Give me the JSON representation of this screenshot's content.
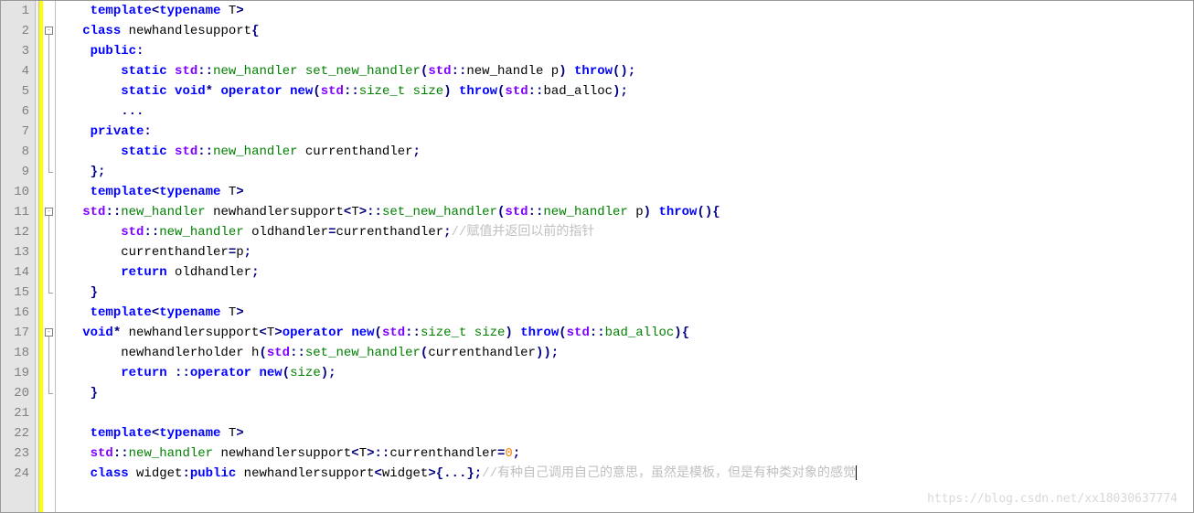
{
  "lines": [
    {
      "n": 1,
      "fold": null,
      "tokens": [
        [
          "    ",
          ""
        ],
        [
          "template",
          "kw"
        ],
        [
          "<",
          "op"
        ],
        [
          "typename",
          "kw"
        ],
        [
          " T",
          ""
        ],
        [
          ">",
          "op"
        ]
      ]
    },
    {
      "n": 2,
      "fold": "box",
      "tokens": [
        [
          "   ",
          ""
        ],
        [
          "class",
          "kw"
        ],
        [
          " newhandlesupport",
          ""
        ],
        [
          "{",
          "op"
        ]
      ]
    },
    {
      "n": 3,
      "fold": "line",
      "tokens": [
        [
          "    ",
          ""
        ],
        [
          "public",
          "kw"
        ],
        [
          ":",
          "op"
        ]
      ]
    },
    {
      "n": 4,
      "fold": "line",
      "tokens": [
        [
          "        ",
          ""
        ],
        [
          "static",
          "kw"
        ],
        [
          " ",
          ""
        ],
        [
          "std",
          "type"
        ],
        [
          "::",
          "op"
        ],
        [
          "new_handler",
          "func"
        ],
        [
          " ",
          ""
        ],
        [
          "set_new_handler",
          "func"
        ],
        [
          "(",
          "op"
        ],
        [
          "std",
          "type"
        ],
        [
          "::",
          "op"
        ],
        [
          "new_handle p",
          ""
        ],
        [
          ")",
          "op"
        ],
        [
          " ",
          ""
        ],
        [
          "throw",
          "kw"
        ],
        [
          "()",
          "op"
        ],
        [
          ";",
          "op"
        ]
      ]
    },
    {
      "n": 5,
      "fold": "line",
      "tokens": [
        [
          "        ",
          ""
        ],
        [
          "static",
          "kw"
        ],
        [
          " ",
          ""
        ],
        [
          "void",
          "kw"
        ],
        [
          "*",
          "op"
        ],
        [
          " ",
          ""
        ],
        [
          "operator",
          "kw"
        ],
        [
          " ",
          ""
        ],
        [
          "new",
          "kw"
        ],
        [
          "(",
          "op"
        ],
        [
          "std",
          "type"
        ],
        [
          "::",
          "op"
        ],
        [
          "size_t",
          "func"
        ],
        [
          " ",
          ""
        ],
        [
          "size",
          "func"
        ],
        [
          ")",
          "op"
        ],
        [
          " ",
          ""
        ],
        [
          "throw",
          "kw"
        ],
        [
          "(",
          "op"
        ],
        [
          "std",
          "type"
        ],
        [
          "::",
          "op"
        ],
        [
          "bad_alloc",
          ""
        ],
        [
          ")",
          "op"
        ],
        [
          ";",
          "op"
        ]
      ]
    },
    {
      "n": 6,
      "fold": "line",
      "tokens": [
        [
          "        ",
          ""
        ],
        [
          "...",
          "op"
        ]
      ]
    },
    {
      "n": 7,
      "fold": "line",
      "tokens": [
        [
          "    ",
          ""
        ],
        [
          "private",
          "kw"
        ],
        [
          ":",
          "op"
        ]
      ]
    },
    {
      "n": 8,
      "fold": "line",
      "tokens": [
        [
          "        ",
          ""
        ],
        [
          "static",
          "kw"
        ],
        [
          " ",
          ""
        ],
        [
          "std",
          "type"
        ],
        [
          "::",
          "op"
        ],
        [
          "new_handler",
          "func"
        ],
        [
          " currenthandler",
          ""
        ],
        [
          ";",
          "op"
        ]
      ]
    },
    {
      "n": 9,
      "fold": "end",
      "tokens": [
        [
          "    ",
          ""
        ],
        [
          "}",
          "op"
        ],
        [
          ";",
          "op"
        ]
      ]
    },
    {
      "n": 10,
      "fold": null,
      "tokens": [
        [
          "    ",
          ""
        ],
        [
          "template",
          "kw"
        ],
        [
          "<",
          "op"
        ],
        [
          "typename",
          "kw"
        ],
        [
          " T",
          ""
        ],
        [
          ">",
          "op"
        ]
      ]
    },
    {
      "n": 11,
      "fold": "box",
      "tokens": [
        [
          "   ",
          ""
        ],
        [
          "std",
          "type"
        ],
        [
          "::",
          "op"
        ],
        [
          "new_handler",
          "func"
        ],
        [
          " newhandlersupport",
          ""
        ],
        [
          "<",
          "op"
        ],
        [
          "T",
          ""
        ],
        [
          ">",
          "op"
        ],
        [
          "::",
          "op"
        ],
        [
          "set_new_handler",
          "func"
        ],
        [
          "(",
          "op"
        ],
        [
          "std",
          "type"
        ],
        [
          "::",
          "op"
        ],
        [
          "new_handler",
          "func"
        ],
        [
          " p",
          ""
        ],
        [
          ")",
          "op"
        ],
        [
          " ",
          ""
        ],
        [
          "throw",
          "kw"
        ],
        [
          "()",
          "op"
        ],
        [
          "{",
          "op"
        ]
      ]
    },
    {
      "n": 12,
      "fold": "line",
      "tokens": [
        [
          "        ",
          ""
        ],
        [
          "std",
          "type"
        ],
        [
          "::",
          "op"
        ],
        [
          "new_handler",
          "func"
        ],
        [
          " oldhandler",
          ""
        ],
        [
          "=",
          "op"
        ],
        [
          "currenthandler",
          ""
        ],
        [
          ";",
          "op"
        ],
        [
          "//赋值并返回以前的指针",
          "comment"
        ]
      ]
    },
    {
      "n": 13,
      "fold": "line",
      "tokens": [
        [
          "        currenthandler",
          ""
        ],
        [
          "=",
          "op"
        ],
        [
          "p",
          ""
        ],
        [
          ";",
          "op"
        ]
      ]
    },
    {
      "n": 14,
      "fold": "line",
      "tokens": [
        [
          "        ",
          ""
        ],
        [
          "return",
          "kw"
        ],
        [
          " oldhandler",
          ""
        ],
        [
          ";",
          "op"
        ]
      ]
    },
    {
      "n": 15,
      "fold": "end",
      "tokens": [
        [
          "    ",
          ""
        ],
        [
          "}",
          "op"
        ]
      ]
    },
    {
      "n": 16,
      "fold": null,
      "tokens": [
        [
          "    ",
          ""
        ],
        [
          "template",
          "kw"
        ],
        [
          "<",
          "op"
        ],
        [
          "typename",
          "kw"
        ],
        [
          " T",
          ""
        ],
        [
          ">",
          "op"
        ]
      ]
    },
    {
      "n": 17,
      "fold": "box",
      "tokens": [
        [
          "   ",
          ""
        ],
        [
          "void",
          "kw"
        ],
        [
          "*",
          "op"
        ],
        [
          " newhandlersupport",
          ""
        ],
        [
          "<",
          "op"
        ],
        [
          "T",
          ""
        ],
        [
          ">",
          "op"
        ],
        [
          "operator",
          "kw"
        ],
        [
          " ",
          ""
        ],
        [
          "new",
          "kw"
        ],
        [
          "(",
          "op"
        ],
        [
          "std",
          "type"
        ],
        [
          "::",
          "op"
        ],
        [
          "size_t",
          "func"
        ],
        [
          " ",
          ""
        ],
        [
          "size",
          "func"
        ],
        [
          ")",
          "op"
        ],
        [
          " ",
          ""
        ],
        [
          "throw",
          "kw"
        ],
        [
          "(",
          "op"
        ],
        [
          "std",
          "type"
        ],
        [
          "::",
          "op"
        ],
        [
          "bad_alloc",
          "func"
        ],
        [
          ")",
          "op"
        ],
        [
          "{",
          "op"
        ]
      ]
    },
    {
      "n": 18,
      "fold": "line",
      "tokens": [
        [
          "        newhandlerholder h",
          ""
        ],
        [
          "(",
          "op"
        ],
        [
          "std",
          "type"
        ],
        [
          "::",
          "op"
        ],
        [
          "set_new_handler",
          "func"
        ],
        [
          "(",
          "op"
        ],
        [
          "currenthandler",
          ""
        ],
        [
          "))",
          "op"
        ],
        [
          ";",
          "op"
        ]
      ]
    },
    {
      "n": 19,
      "fold": "line",
      "tokens": [
        [
          "        ",
          ""
        ],
        [
          "return",
          "kw"
        ],
        [
          " ",
          ""
        ],
        [
          "::",
          "op"
        ],
        [
          "operator",
          "kw"
        ],
        [
          " ",
          ""
        ],
        [
          "new",
          "kw"
        ],
        [
          "(",
          "op"
        ],
        [
          "size",
          "func"
        ],
        [
          ")",
          "op"
        ],
        [
          ";",
          "op"
        ]
      ]
    },
    {
      "n": 20,
      "fold": "end",
      "tokens": [
        [
          "    ",
          ""
        ],
        [
          "}",
          "op"
        ]
      ]
    },
    {
      "n": 21,
      "fold": null,
      "tokens": [
        [
          "",
          ""
        ]
      ]
    },
    {
      "n": 22,
      "fold": null,
      "tokens": [
        [
          "    ",
          ""
        ],
        [
          "template",
          "kw"
        ],
        [
          "<",
          "op"
        ],
        [
          "typename",
          "kw"
        ],
        [
          " T",
          ""
        ],
        [
          ">",
          "op"
        ]
      ]
    },
    {
      "n": 23,
      "fold": null,
      "tokens": [
        [
          "    ",
          ""
        ],
        [
          "std",
          "type"
        ],
        [
          "::",
          "op"
        ],
        [
          "new_handler",
          "func"
        ],
        [
          " newhandlersupport",
          ""
        ],
        [
          "<",
          "op"
        ],
        [
          "T",
          ""
        ],
        [
          ">",
          "op"
        ],
        [
          "::",
          "op"
        ],
        [
          "currenthandler",
          ""
        ],
        [
          "=",
          "op"
        ],
        [
          "0",
          "num"
        ],
        [
          ";",
          "op"
        ]
      ]
    },
    {
      "n": 24,
      "fold": null,
      "tokens": [
        [
          "    ",
          ""
        ],
        [
          "class",
          "kw"
        ],
        [
          " widget",
          ""
        ],
        [
          ":",
          "op"
        ],
        [
          "public",
          "kw"
        ],
        [
          " newhandlersupport",
          ""
        ],
        [
          "<",
          "op"
        ],
        [
          "widget",
          ""
        ],
        [
          ">",
          "op"
        ],
        [
          "{",
          "op"
        ],
        [
          "...",
          "op"
        ],
        [
          "}",
          "op"
        ],
        [
          ";",
          "op"
        ],
        [
          "//有种自己调用自己的意思，虽然是模板，但是有种类对象的感觉",
          "comment"
        ]
      ]
    }
  ],
  "watermark": "https://blog.csdn.net/xx18030637774",
  "fold_ranges": [
    {
      "start": 2,
      "end": 9
    },
    {
      "start": 11,
      "end": 15
    },
    {
      "start": 17,
      "end": 20
    }
  ]
}
